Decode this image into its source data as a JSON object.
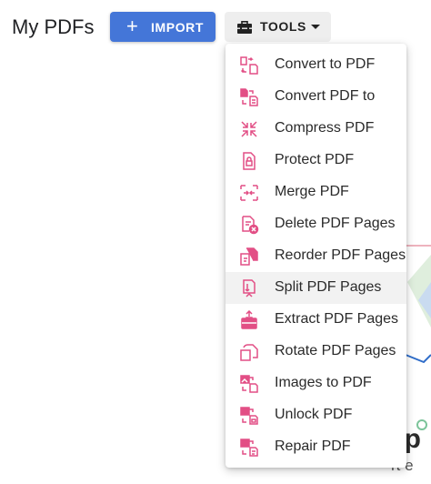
{
  "header": {
    "title": "My PDFs",
    "import_label": "IMPORT",
    "tools_label": "TOOLS"
  },
  "background": {
    "partial_heading": "mp",
    "partial_text": "rt e"
  },
  "colors": {
    "primary": "#4476d8",
    "icon_pink": "#e24f85",
    "hover": "#f2f2f2"
  },
  "tools_menu": {
    "hovered_item": "Split PDF Pages",
    "items": [
      {
        "label": "Convert to PDF",
        "icon": "convert-to-pdf-icon"
      },
      {
        "label": "Convert PDF to",
        "icon": "convert-pdf-to-icon"
      },
      {
        "label": "Compress PDF",
        "icon": "compress-icon"
      },
      {
        "label": "Protect PDF",
        "icon": "lock-file-icon"
      },
      {
        "label": "Merge PDF",
        "icon": "merge-icon"
      },
      {
        "label": "Delete PDF Pages",
        "icon": "delete-pages-icon"
      },
      {
        "label": "Reorder PDF Pages",
        "icon": "reorder-pages-icon"
      },
      {
        "label": "Split PDF Pages",
        "icon": "split-pages-icon"
      },
      {
        "label": "Extract PDF Pages",
        "icon": "extract-pages-icon"
      },
      {
        "label": "Rotate PDF Pages",
        "icon": "rotate-pages-icon"
      },
      {
        "label": "Images to PDF",
        "icon": "images-to-pdf-icon"
      },
      {
        "label": "Unlock PDF",
        "icon": "unlock-pdf-icon"
      },
      {
        "label": "Repair PDF",
        "icon": "repair-pdf-icon"
      }
    ]
  }
}
